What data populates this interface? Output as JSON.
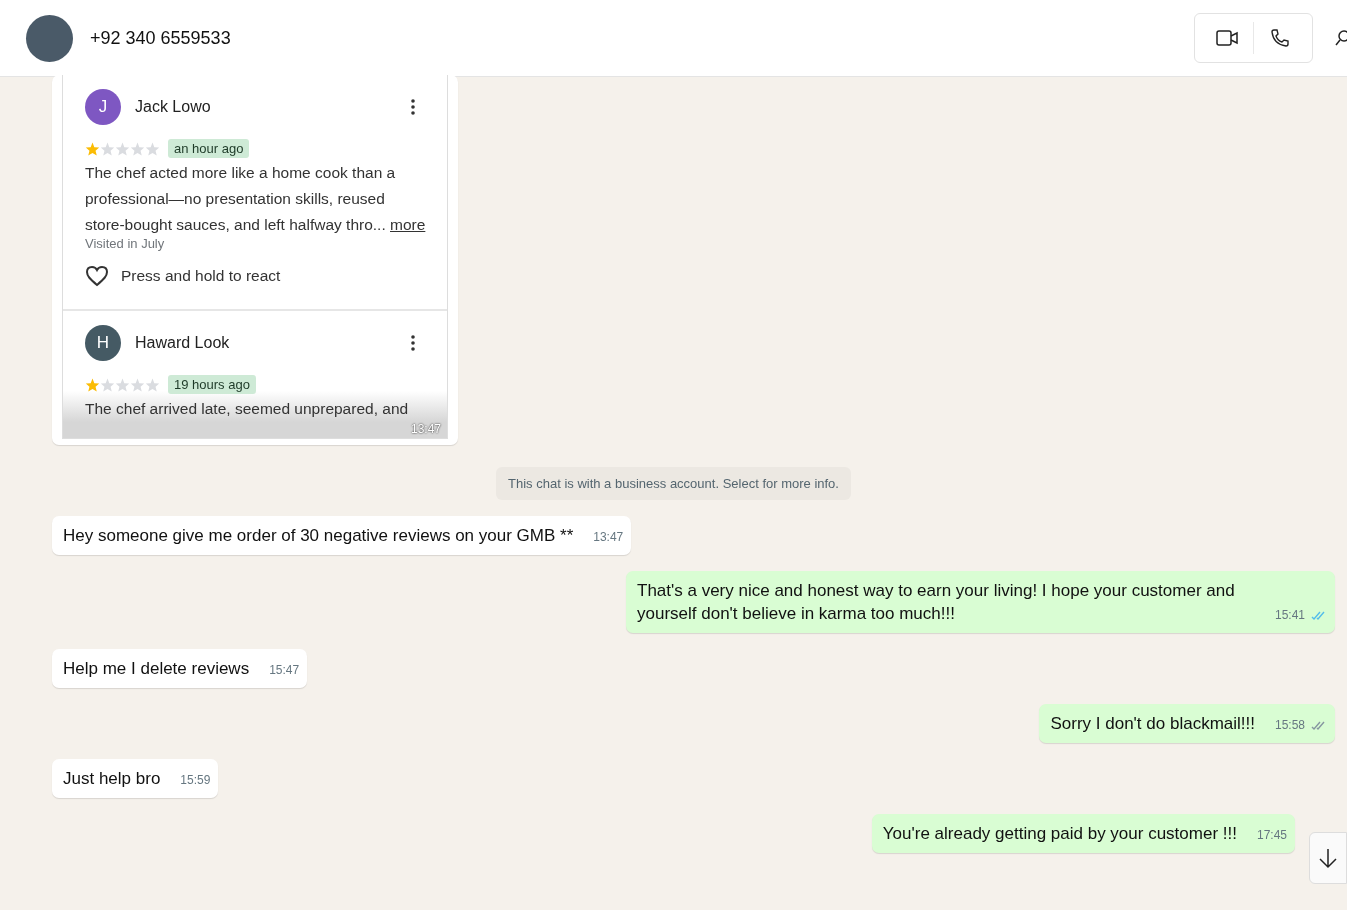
{
  "header": {
    "contact": "+92 340 6559533"
  },
  "messages": [
    {
      "kind": "image",
      "outgoing": false,
      "time": "13:47",
      "reviews": [
        {
          "initial": "J",
          "color": "#7e57c2",
          "name": "Jack Lowo",
          "stars": 1,
          "age": "an hour ago",
          "lines": [
            "The chef acted more like a home cook than a",
            "professional—no presentation skills, reused",
            "store-bought sauces, and left halfway thro..."
          ],
          "more": "more",
          "visited": "Visited in July",
          "react": "Press and hold to react"
        },
        {
          "initial": "H",
          "color": "#455a64",
          "name": "Haward Look",
          "stars": 1,
          "age": "19 hours ago",
          "lines": [
            "The chef arrived late, seemed unprepared, and"
          ]
        }
      ]
    },
    {
      "kind": "system",
      "text": "This chat is with a business account. Select for more info."
    },
    {
      "kind": "text",
      "outgoing": false,
      "text": "Hey someone give me order of 30 negative reviews on your GMB **",
      "time": "13:47"
    },
    {
      "kind": "text",
      "outgoing": true,
      "text": "That's a very nice and honest way to earn your living! I hope your customer and yourself don't believe in karma too much!!!",
      "time": "15:41",
      "read": true
    },
    {
      "kind": "text",
      "outgoing": false,
      "text": "Help me I delete reviews",
      "time": "15:47"
    },
    {
      "kind": "text",
      "outgoing": true,
      "text": "Sorry I don't do blackmail!!!",
      "time": "15:58",
      "read": false
    },
    {
      "kind": "text",
      "outgoing": false,
      "text": "Just help bro",
      "time": "15:59"
    },
    {
      "kind": "text",
      "outgoing": true,
      "text": "You're already getting paid by your customer !!!",
      "time": "17:45"
    }
  ]
}
